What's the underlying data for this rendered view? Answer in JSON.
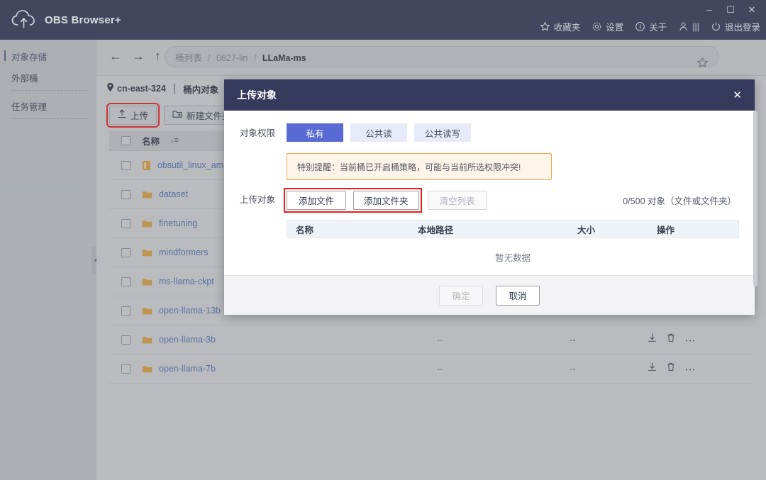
{
  "window": {
    "app_title": "OBS Browser+",
    "logo_icon": "cloud-upload-icon",
    "minimize": "–",
    "maximize": "☐",
    "close": "✕"
  },
  "header_menu": [
    {
      "icon": "star-icon",
      "label": "收藏夹"
    },
    {
      "icon": "gear-icon",
      "label": "设置"
    },
    {
      "icon": "info-icon",
      "label": "关于"
    },
    {
      "icon": "user-icon",
      "label": "|||"
    },
    {
      "icon": "power-icon",
      "label": "退出登录"
    }
  ],
  "sidebar": {
    "items": [
      {
        "label": "对象存储",
        "active": true
      },
      {
        "label": "外部桶",
        "active": false
      },
      {
        "label": "任务管理",
        "active": false
      }
    ]
  },
  "nav": {
    "back_icon": "arrow-left-icon",
    "forward_icon": "arrow-right-icon",
    "up_icon": "arrow-up-icon",
    "favorite_icon": "star-outline-icon",
    "breadcrumb": {
      "root": "桶列表",
      "bucket": "0827-lin",
      "current": "LLaMa-ms",
      "separator": "/"
    }
  },
  "bucket_bar": {
    "region_icon": "location-pin-icon",
    "region": "cn-east-324",
    "divider": "|",
    "tab": "桶内对象"
  },
  "toolbar": {
    "upload_label": "上传",
    "upload_icon": "upload-icon",
    "new_folder_label": "新建文件夹",
    "new_folder_icon": "folder-plus-icon"
  },
  "file_table": {
    "columns": {
      "name": "名称",
      "size": "",
      "time": "",
      "action": ""
    },
    "sort_icon": "sort-icon",
    "rows": [
      {
        "name": "obsutil_linux_am",
        "type": "file",
        "size": "",
        "time": "",
        "actions": [
          "download-icon",
          "delete-icon",
          "more-icon"
        ]
      },
      {
        "name": "dataset",
        "type": "folder",
        "size": "",
        "time": "",
        "actions": [
          "download-icon",
          "delete-icon",
          "more-icon"
        ]
      },
      {
        "name": "finetuning",
        "type": "folder",
        "size": "",
        "time": "",
        "actions": [
          "download-icon",
          "delete-icon",
          "more-icon"
        ]
      },
      {
        "name": "mindformers",
        "type": "folder",
        "size": "",
        "time": "",
        "actions": [
          "download-icon",
          "delete-icon",
          "more-icon"
        ]
      },
      {
        "name": "ms-llama-ckpt",
        "type": "folder",
        "size": "",
        "time": "",
        "actions": [
          "download-icon",
          "delete-icon",
          "more-icon"
        ]
      },
      {
        "name": "open-llama-13b",
        "type": "folder",
        "size": "",
        "time": "",
        "actions": [
          "download-icon",
          "delete-icon",
          "more-icon"
        ]
      },
      {
        "name": "open-llama-3b",
        "type": "folder",
        "size": "--",
        "time": "--",
        "actions": [
          "download-icon",
          "delete-icon",
          "more-icon"
        ]
      },
      {
        "name": "open-llama-7b",
        "type": "folder",
        "size": "--",
        "time": "--",
        "actions": [
          "download-icon",
          "delete-icon",
          "more-icon"
        ]
      }
    ]
  },
  "modal": {
    "title": "上传对象",
    "close_icon": "close-icon",
    "permission_label": "对象权限",
    "permission_options": [
      {
        "label": "私有",
        "selected": true
      },
      {
        "label": "公共读",
        "selected": false
      },
      {
        "label": "公共读写",
        "selected": false
      }
    ],
    "warning": "特别提醒：当前桶已开启桶策略，可能与当前所选权限冲突!",
    "upload_label": "上传对象",
    "add_file_label": "添加文件",
    "add_folder_label": "添加文件夹",
    "clear_list_label": "清空列表",
    "count_text": "0/500 对象（文件或文件夹）",
    "table_headers": {
      "name": "名称",
      "path": "本地路径",
      "size": "大小",
      "action": "操作"
    },
    "empty_text": "暂无数据",
    "confirm_label": "确定",
    "cancel_label": "取消"
  },
  "colors": {
    "titlebar": "#2f3453",
    "modal_header": "#353a5c",
    "accent": "#5a6ad4",
    "highlight_outline": "#ef1a1a",
    "warning_bg": "#fef4e9",
    "warning_border": "#eca850",
    "link": "#4a6fb5",
    "folder": "#d9a03c"
  }
}
